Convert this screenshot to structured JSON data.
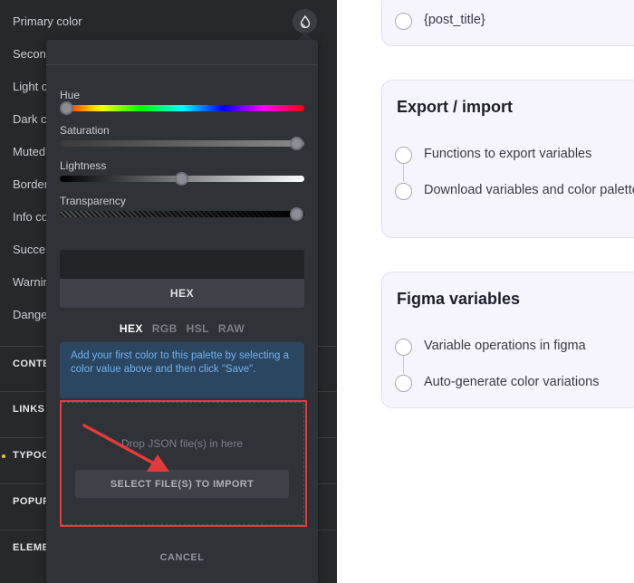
{
  "sidebar": {
    "rows": [
      "Primary color",
      "Secon",
      "Light c",
      "Dark c",
      "Muted",
      "Border",
      "Info co",
      "Succe",
      "Warnin",
      "Dange"
    ],
    "sections": [
      "CONTE",
      "LINKS",
      "TYPOG",
      "POPUP",
      "ELEME"
    ],
    "drop_icon": "droplet-icon"
  },
  "picker": {
    "sliders": {
      "hue": {
        "label": "Hue",
        "value": 0
      },
      "saturation": {
        "label": "Saturation",
        "value": 1
      },
      "lightness": {
        "label": "Lightness",
        "value": 0.5
      },
      "transparency": {
        "label": "Transparency",
        "value": 1
      }
    },
    "hex_bar": "HEX",
    "formats": [
      "HEX",
      "RGB",
      "HSL",
      "RAW"
    ],
    "active_format": "HEX",
    "info": "Add your first color to this palette by selecting a color value above and then click \"Save\".",
    "drop_text": "Drop JSON file(s) in here",
    "select_button": "SELECT FILE(S) TO IMPORT",
    "cancel": "CANCEL"
  },
  "cards": {
    "top": {
      "item": "{post_title}"
    },
    "export_import": {
      "title": "Export / import",
      "items": [
        "Functions to export variables",
        "Download variables and color palette"
      ]
    },
    "figma": {
      "title": "Figma variables",
      "items": [
        "Variable operations in figma",
        "Auto-generate color variations"
      ]
    }
  },
  "colors": {
    "sidebar_bg": "#26282b",
    "panel_bg": "#2f3237",
    "info_bg": "#2b4660",
    "info_text": "#6fb3ee",
    "highlight": "#e33b3b",
    "card_bg": "#f6f5fd"
  }
}
